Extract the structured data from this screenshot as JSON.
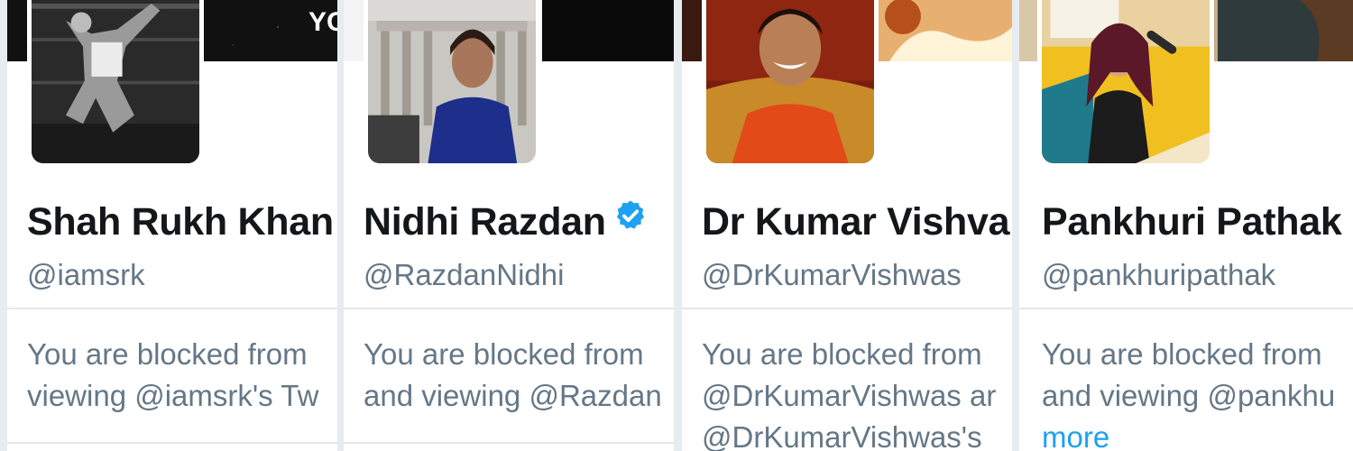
{
  "cards": [
    {
      "name": "Shah Rukh Khan",
      "handle": "@iamsrk",
      "verified": false,
      "blocked_line1": "You are blocked from",
      "blocked_line2": "viewing @iamsrk's Tw",
      "banner_text": "YO"
    },
    {
      "name": "Nidhi Razdan",
      "handle": "@RazdanNidhi",
      "verified": true,
      "blocked_line1": "You are blocked from",
      "blocked_line2": "and viewing @Razdan"
    },
    {
      "name": "Dr Kumar Vishva",
      "handle": "@DrKumarVishwas",
      "verified": false,
      "blocked_line1": "You are blocked from",
      "blocked_line2": "@DrKumarVishwas ar",
      "blocked_line3": "@DrKumarVishwas's"
    },
    {
      "name": "Pankhuri Pathak",
      "handle": "@pankhuripathak",
      "verified": false,
      "blocked_line1": "You are blocked from",
      "blocked_line2": "and viewing @pankhu",
      "more_link": "more"
    }
  ],
  "colors": {
    "name": "#14171a",
    "muted": "#657786",
    "link": "#1da1f2",
    "verified_badge": "#1da1f2",
    "divider": "#e1e8ed"
  },
  "icons": {
    "verified": "verified-badge-icon"
  }
}
